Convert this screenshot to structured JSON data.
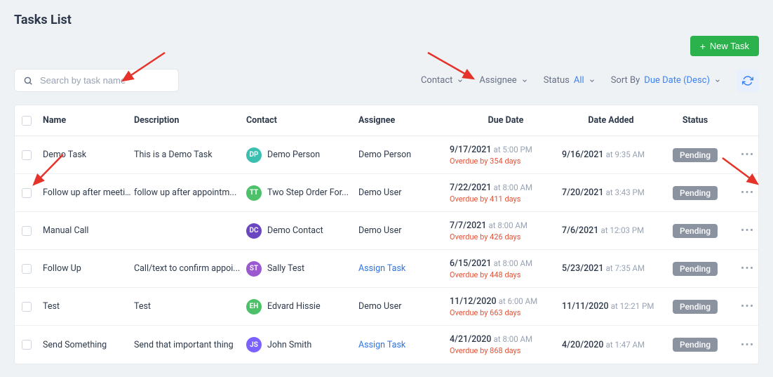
{
  "header": {
    "title": "Tasks List",
    "new_button": "New Task"
  },
  "search": {
    "placeholder": "Search by task name"
  },
  "filters": {
    "contact": "Contact",
    "assignee": "Assignee",
    "status_label": "Status",
    "status_value": "All",
    "sortby_label": "Sort By",
    "sortby_value": "Due Date (Desc)"
  },
  "columns": {
    "name": "Name",
    "description": "Description",
    "contact": "Contact",
    "assignee": "Assignee",
    "due": "Due Date",
    "added": "Date Added",
    "status": "Status"
  },
  "rows": [
    {
      "name": "Demo Task",
      "description": "This is a Demo Task",
      "contact": {
        "initials": "DP",
        "name": "Demo Person",
        "color": "#3bbfb0"
      },
      "assignee": "Demo Person",
      "due_date": "9/17/2021",
      "due_time": "at 5:00 PM",
      "overdue": "Overdue by 354 days",
      "added_date": "9/16/2021",
      "added_time": "at 9:35 AM",
      "status": "Pending"
    },
    {
      "name": "Follow up after meeting",
      "description": "follow up after appointm...",
      "contact": {
        "initials": "TT",
        "name": "Two Step Order For...",
        "color": "#4cc16a"
      },
      "assignee": "Demo User",
      "due_date": "7/22/2021",
      "due_time": "at 8:00 AM",
      "overdue": "Overdue by 411 days",
      "added_date": "7/20/2021",
      "added_time": "at 3:43 PM",
      "status": "Pending"
    },
    {
      "name": "Manual Call",
      "description": "",
      "contact": {
        "initials": "DC",
        "name": "Demo Contact",
        "color": "#6b46c1"
      },
      "assignee": "Demo User",
      "due_date": "7/7/2021",
      "due_time": "at 8:00 AM",
      "overdue": "Overdue by 426 days",
      "added_date": "7/6/2021",
      "added_time": "at 12:03 PM",
      "status": "Pending"
    },
    {
      "name": "Follow Up",
      "description": "Call/text to confirm appoi...",
      "contact": {
        "initials": "ST",
        "name": "Sally Test",
        "color": "#9b59d0"
      },
      "assignee_link": "Assign Task",
      "due_date": "6/15/2021",
      "due_time": "at 8:00 AM",
      "overdue": "Overdue by 448 days",
      "added_date": "5/23/2021",
      "added_time": "at 7:35 AM",
      "status": "Pending"
    },
    {
      "name": "Test",
      "description": "Test",
      "contact": {
        "initials": "EH",
        "name": "Edvard Hissie",
        "color": "#4cc16a"
      },
      "assignee": "Demo User",
      "due_date": "11/12/2020",
      "due_time": "at 6:00 AM",
      "overdue": "Overdue by 663 days",
      "added_date": "11/11/2020",
      "added_time": "at 12:21 PM",
      "status": "Pending"
    },
    {
      "name": "Send Something",
      "description": "Send that important thing",
      "contact": {
        "initials": "JS",
        "name": "John Smith",
        "color": "#7b61ff"
      },
      "assignee_link": "Assign Task",
      "due_date": "4/21/2020",
      "due_time": "at 8:00 AM",
      "overdue": "Overdue by 868 days",
      "added_date": "4/20/2020",
      "added_time": "at 1:47 AM",
      "status": "Pending"
    }
  ]
}
